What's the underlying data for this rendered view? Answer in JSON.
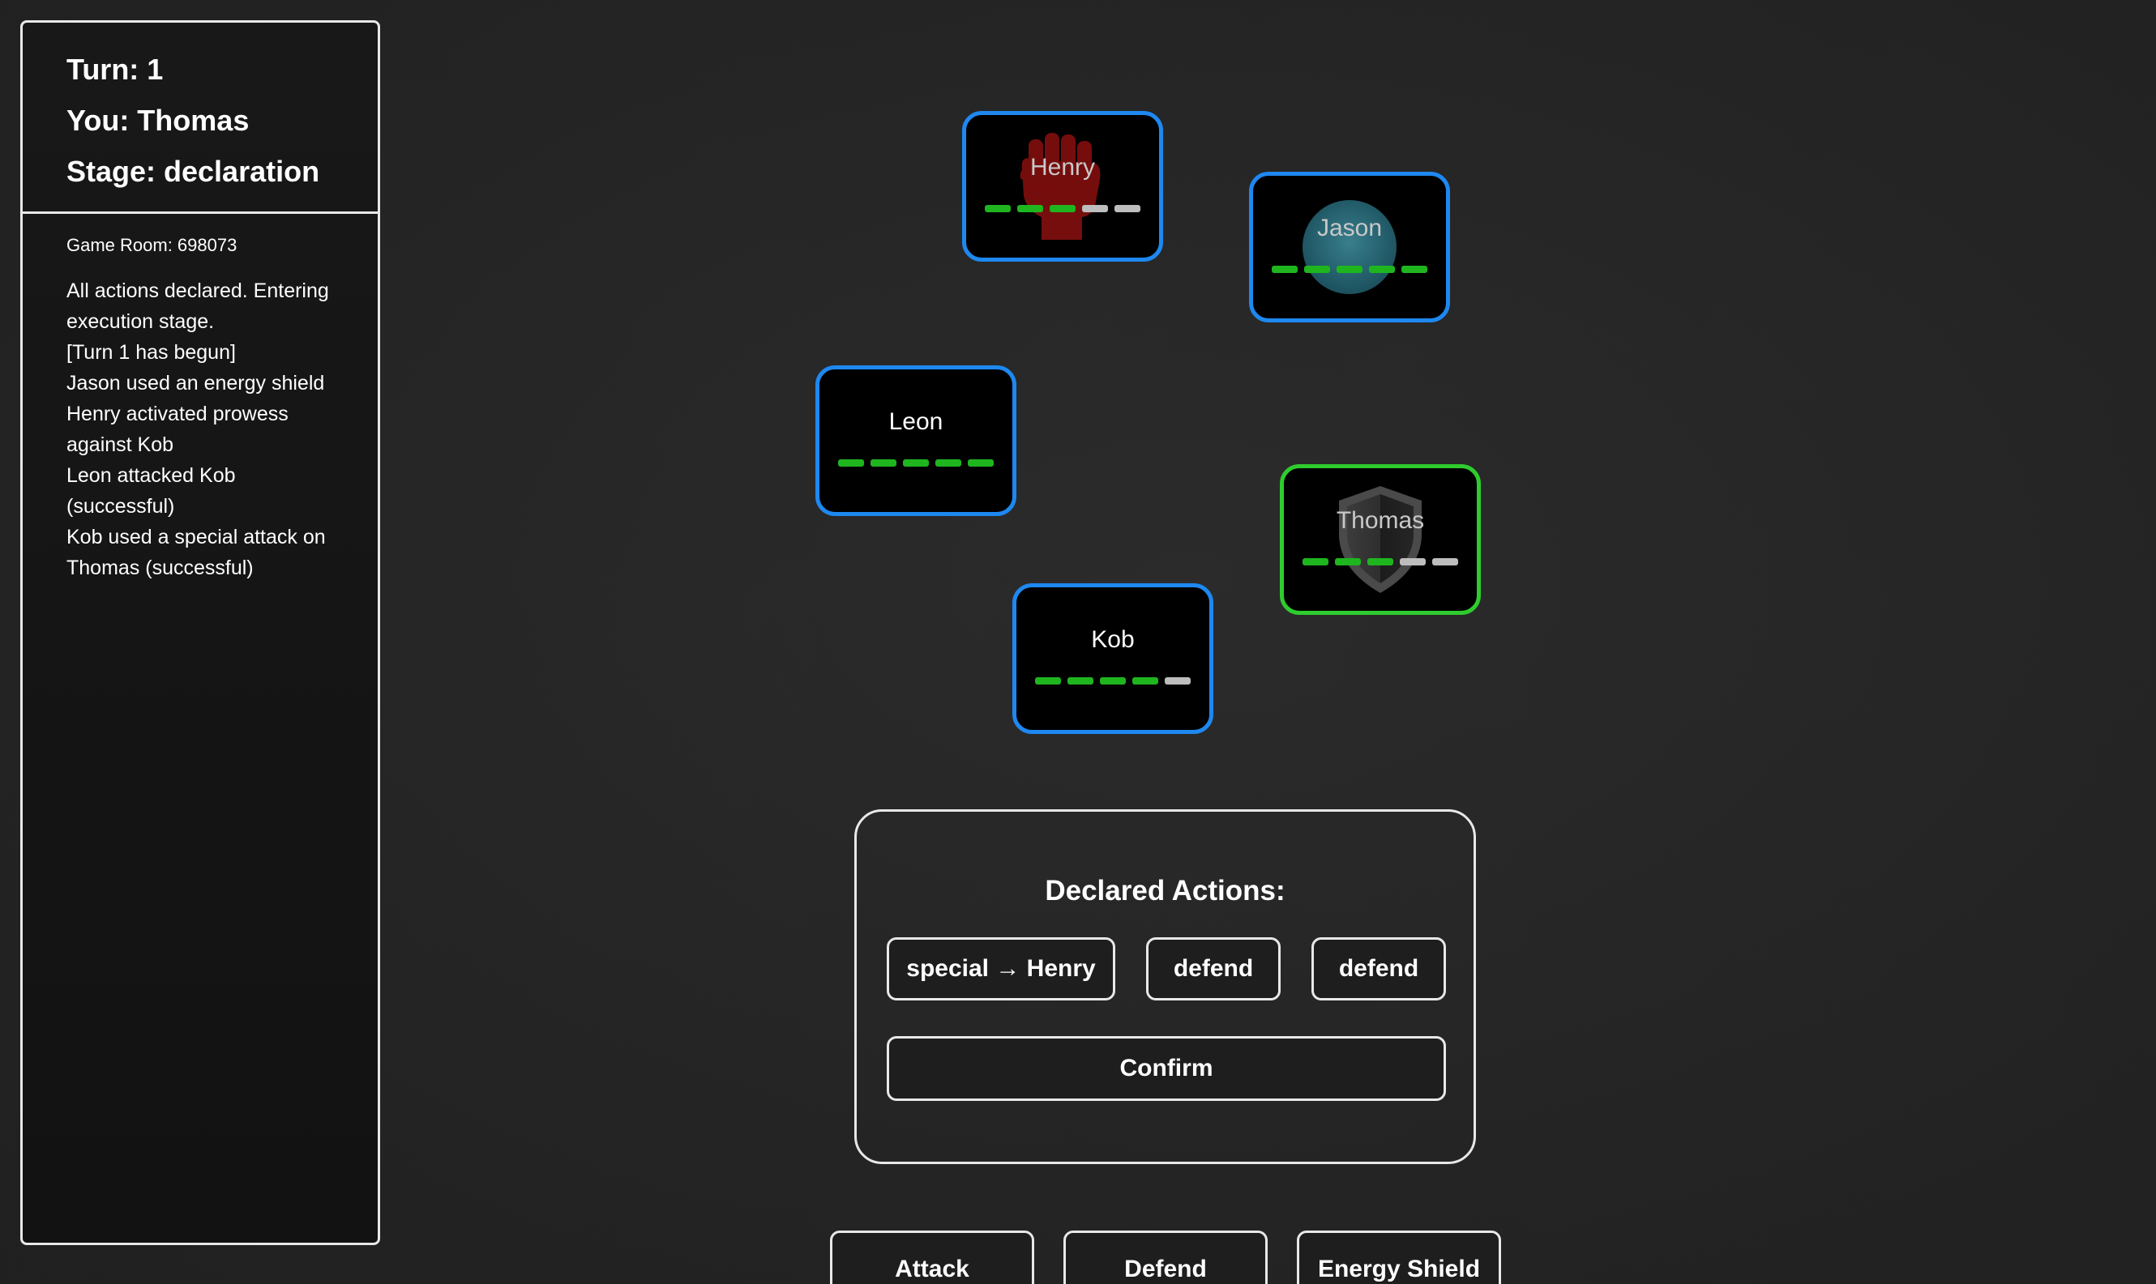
{
  "status": {
    "turn": "Turn: 1",
    "you": "You: Thomas",
    "stage": "Stage: declaration"
  },
  "room": "Game Room: 698073",
  "log": [
    "All actions declared. Entering",
    "execution stage.",
    "[Turn 1 has begun]",
    "Jason used an energy shield",
    "Henry activated prowess",
    "against Kob",
    "Leon attacked Kob",
    "(successful)",
    "Kob used a special attack on",
    "Thomas (successful)"
  ],
  "players": {
    "henry": {
      "name": "Henry",
      "hp": 3,
      "max_hp": 5,
      "emblem": "fist-icon"
    },
    "jason": {
      "name": "Jason",
      "hp": 5,
      "max_hp": 5,
      "emblem": "energy-shield-icon"
    },
    "leon": {
      "name": "Leon",
      "hp": 5,
      "max_hp": 5
    },
    "thomas": {
      "name": "Thomas",
      "hp": 3,
      "max_hp": 5,
      "emblem": "shield-icon"
    },
    "kob": {
      "name": "Kob",
      "hp": 4,
      "max_hp": 5
    }
  },
  "colors": {
    "opponent_border": "#1e88f0",
    "self_border": "#2ecc2e",
    "hp_full": "#1fb51f",
    "hp_empty": "#bdbdbd"
  },
  "declared": {
    "title": "Declared Actions:",
    "chips": [
      "special → Henry",
      "defend",
      "defend"
    ],
    "confirm_label": "Confirm"
  },
  "actions": [
    "Attack",
    "Defend",
    "Energy Shield"
  ]
}
